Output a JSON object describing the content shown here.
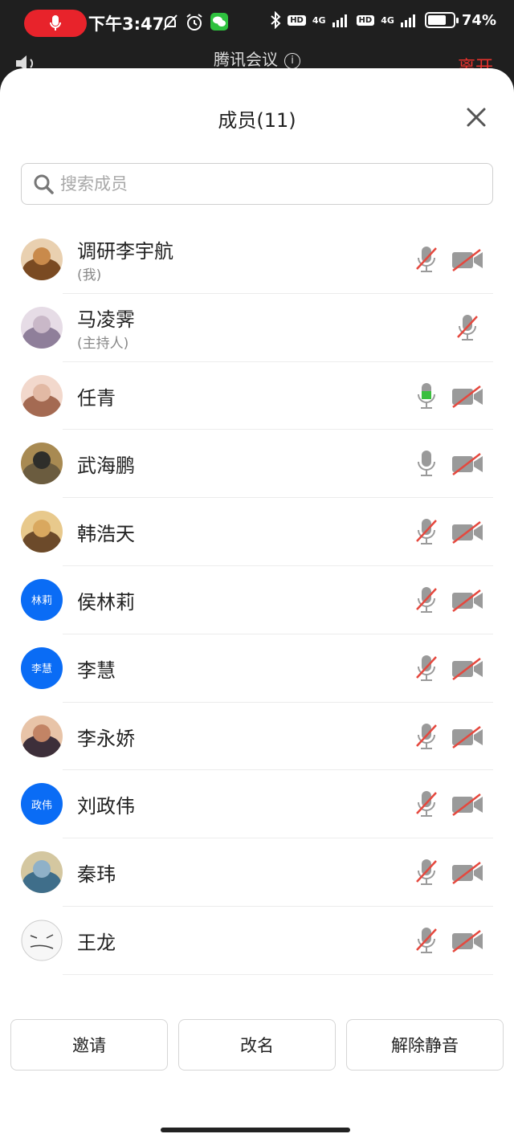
{
  "status_bar": {
    "time": "下午3:47",
    "hd1": "HD",
    "hd2": "HD",
    "network1": "4G",
    "network2": "4G",
    "battery": "74%",
    "battery_level": 0.74
  },
  "app": {
    "title": "腾讯会议",
    "info_icon": "i",
    "leave_label": "离开"
  },
  "sheet": {
    "title": "成员(11)",
    "close_icon": "close-icon"
  },
  "search": {
    "placeholder": "搜索成员"
  },
  "members": [
    {
      "name": "调研李宇航",
      "sub": "(我)",
      "mic": "muted",
      "camera": "off"
    },
    {
      "name": "马凌霁",
      "sub": "(主持人)",
      "mic": "muted",
      "camera": "none"
    },
    {
      "name": "任青",
      "sub": "",
      "mic": "speaking",
      "camera": "off"
    },
    {
      "name": "武海鹏",
      "sub": "",
      "mic": "on",
      "camera": "off"
    },
    {
      "name": "韩浩天",
      "sub": "",
      "mic": "muted",
      "camera": "off"
    },
    {
      "name": "侯林莉",
      "sub": "",
      "avatar_text": "林莉",
      "mic": "muted",
      "camera": "off"
    },
    {
      "name": "李慧",
      "sub": "",
      "avatar_text": "李慧",
      "mic": "muted",
      "camera": "off"
    },
    {
      "name": "李永娇",
      "sub": "",
      "mic": "muted",
      "camera": "off"
    },
    {
      "name": "刘政伟",
      "sub": "",
      "avatar_text": "政伟",
      "mic": "muted",
      "camera": "off"
    },
    {
      "name": "秦玮",
      "sub": "",
      "mic": "muted",
      "camera": "off"
    },
    {
      "name": "王龙",
      "sub": "",
      "mic": "muted",
      "camera": "off"
    }
  ],
  "actions": {
    "invite": "邀请",
    "rename": "改名",
    "unmute_all": "解除静音"
  },
  "colors": {
    "record_red": "#e8232b",
    "avatar_blue": "#0a6cf5",
    "mute_slash": "#e5483e",
    "speaking_green": "#3bbf3f",
    "icon_gray": "#9a9a9a"
  }
}
